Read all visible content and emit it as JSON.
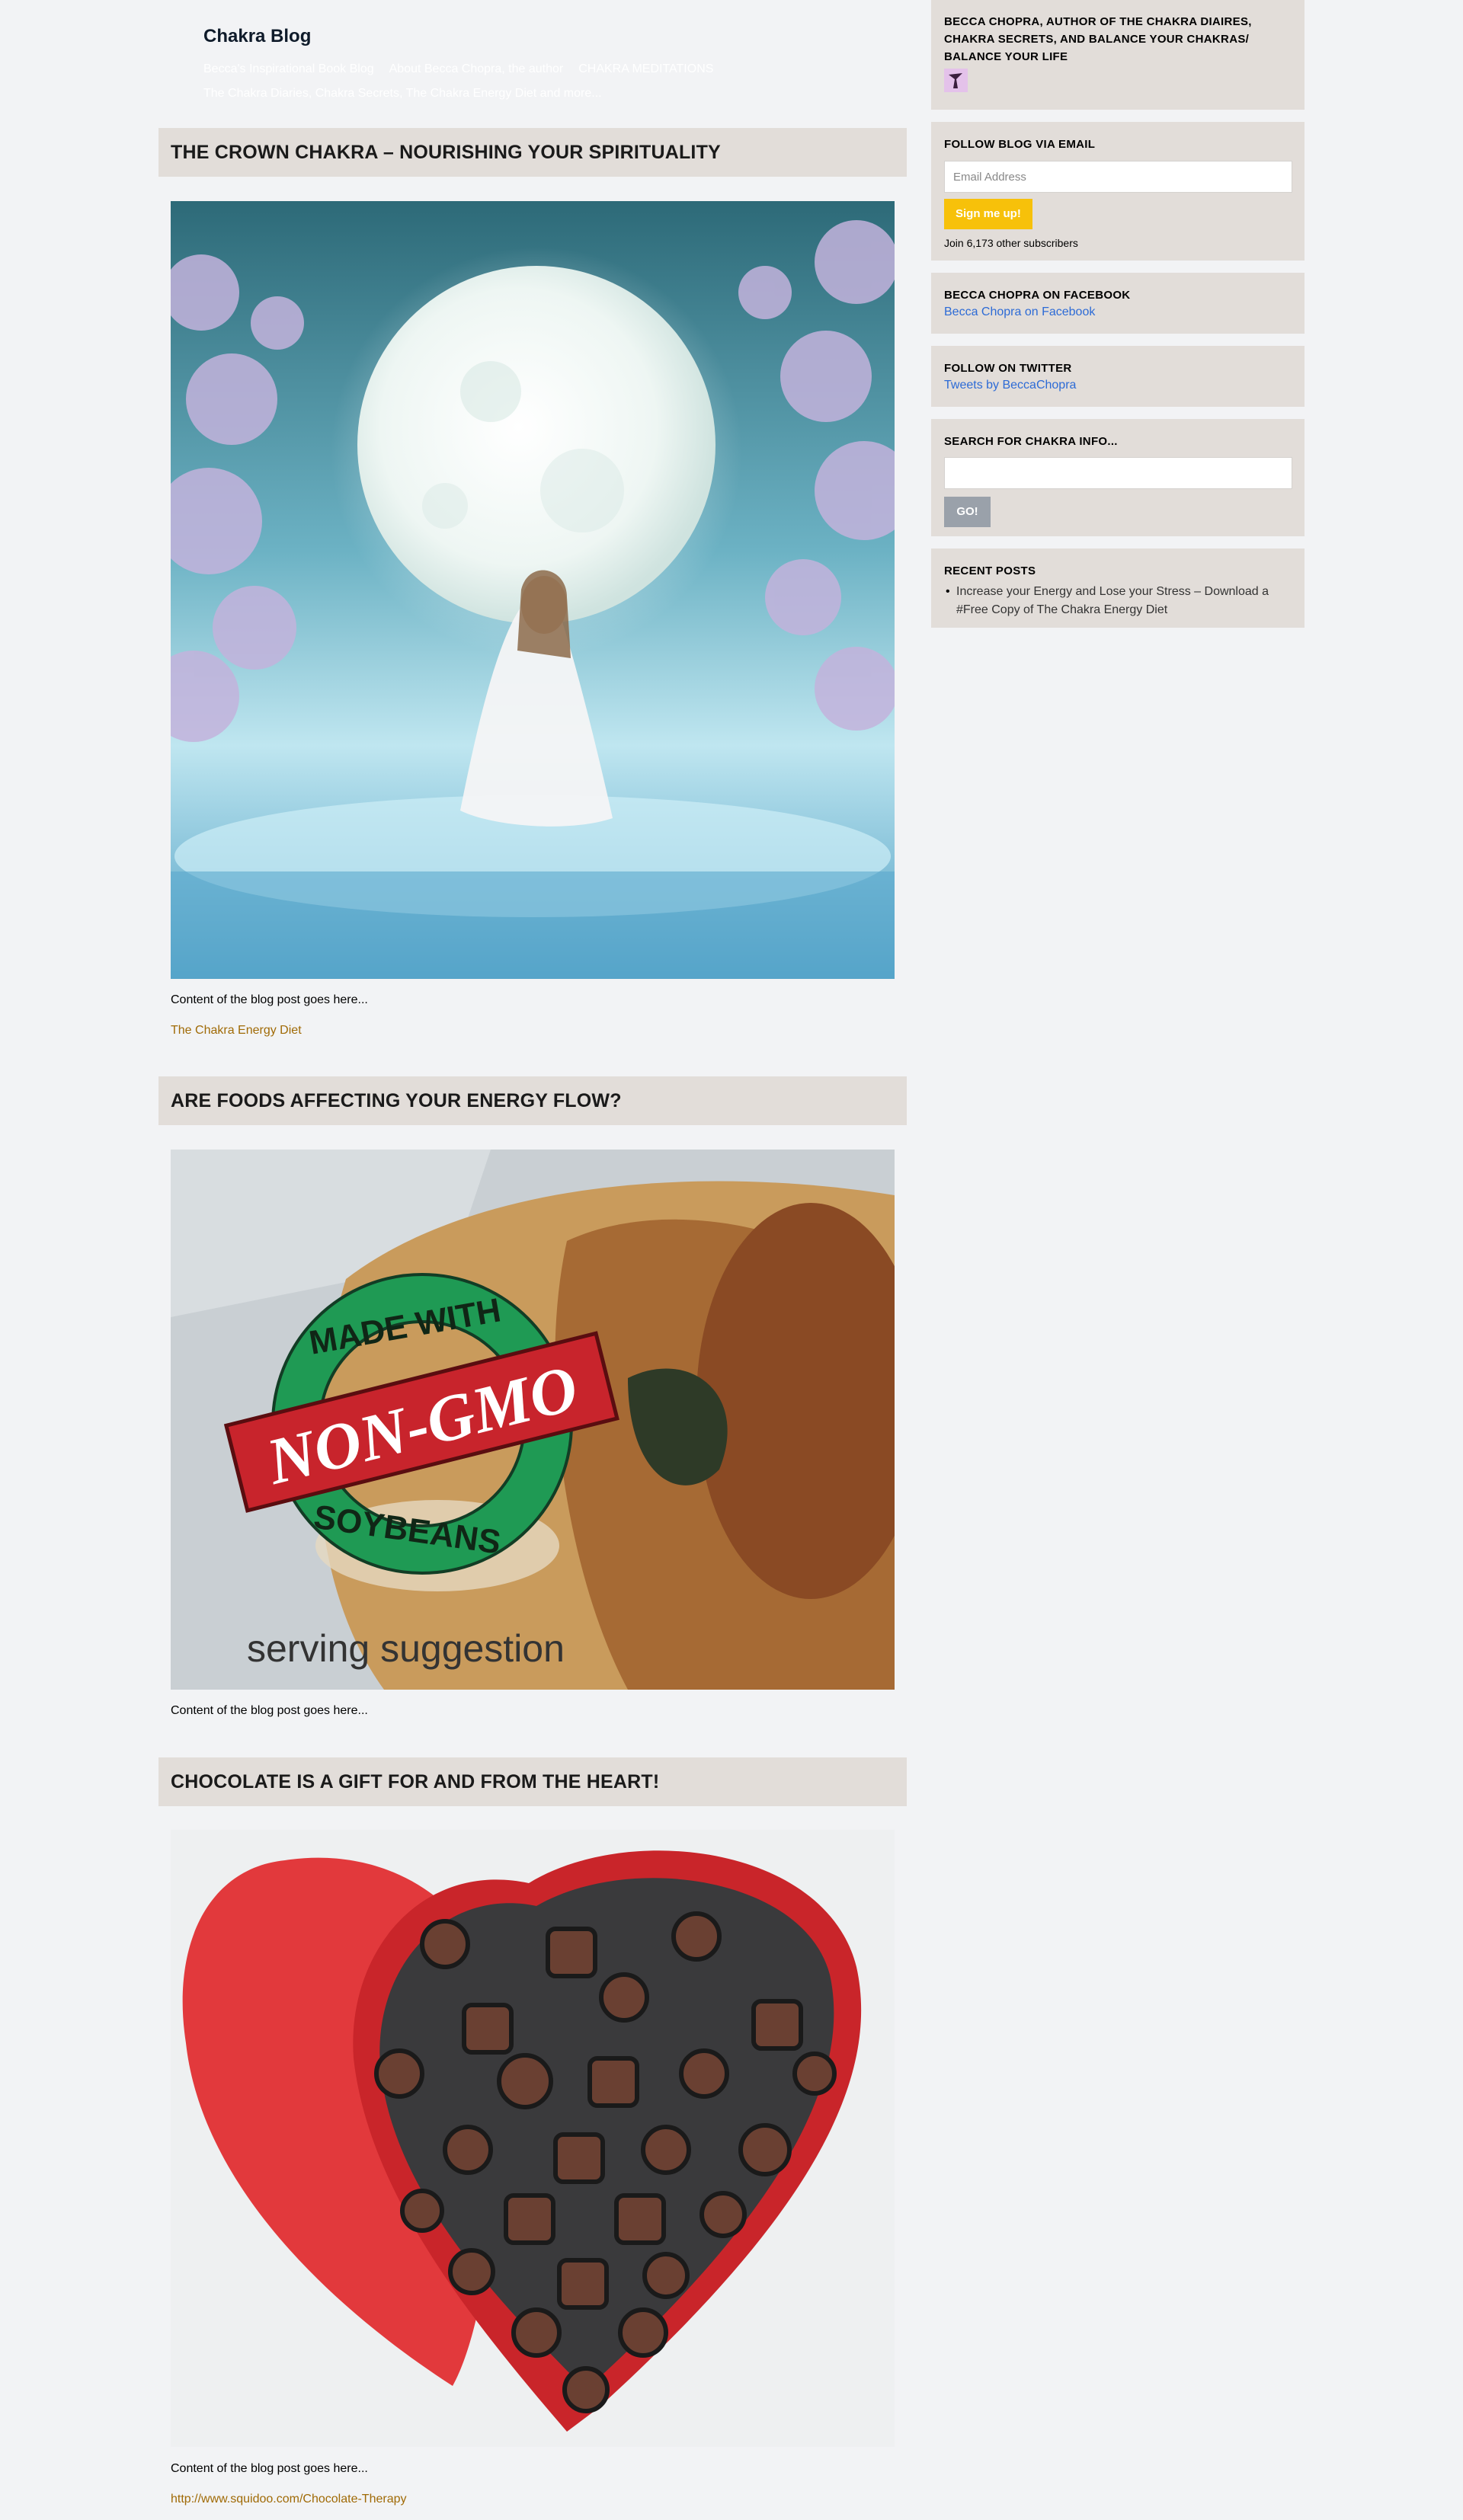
{
  "site": {
    "title": "Chakra Blog",
    "nav": [
      "Becca's Inspirational Book Blog",
      "About Becca Chopra, the author",
      "CHAKRA MEDITATIONS"
    ],
    "tagline": "The Chakra Diaries, Chakra Secrets, The Chakra Energy Diet and more..."
  },
  "posts": [
    {
      "title": "THE CROWN CHAKRA – NOURISHING YOUR SPIRITUALITY",
      "content": "Content of the blog post goes here...",
      "link": "The Chakra Energy Diet"
    },
    {
      "title": "ARE FOODS AFFECTING YOUR ENERGY FLOW?",
      "content": "Content of the blog post goes here...",
      "image_text": {
        "ring_top": "MADE WITH",
        "banner": "NON-GMO",
        "ring_bottom": "SOYBEANS",
        "caption": "serving suggestion"
      }
    },
    {
      "title": "CHOCOLATE IS A GIFT FOR AND FROM THE HEART!",
      "content": "Content of the blog post goes here...",
      "link": "http://www.squidoo.com/Chocolate-Therapy"
    }
  ],
  "sidebar": {
    "author": {
      "title": "BECCA CHOPRA, AUTHOR OF THE CHAKRA DIAIRES, CHAKRA SECRETS, AND BALANCE YOUR CHAKRAS/ BALANCE YOUR LIFE"
    },
    "email": {
      "title": "FOLLOW BLOG VIA EMAIL",
      "placeholder": "Email Address",
      "button": "Sign me up!",
      "subscribers": "Join 6,173 other subscribers"
    },
    "facebook": {
      "title": "BECCA CHOPRA ON FACEBOOK",
      "link": "Becca Chopra on Facebook"
    },
    "twitter": {
      "title": "FOLLOW ON TWITTER",
      "link": "Tweets by BeccaChopra"
    },
    "search": {
      "title": "SEARCH FOR CHAKRA INFO...",
      "button": "GO!"
    },
    "recent": {
      "title": "RECENT POSTS",
      "items": [
        "Increase your Energy and Lose your Stress – Download a #Free Copy of The Chakra Energy Diet"
      ]
    }
  },
  "colors": {
    "widget_bg": "#e2ddd9",
    "page_bg": "#f2f3f5",
    "link": "#2d6bd6",
    "post_link": "#a06a06",
    "signup": "#f7c10a",
    "go": "#9aa1aa"
  }
}
